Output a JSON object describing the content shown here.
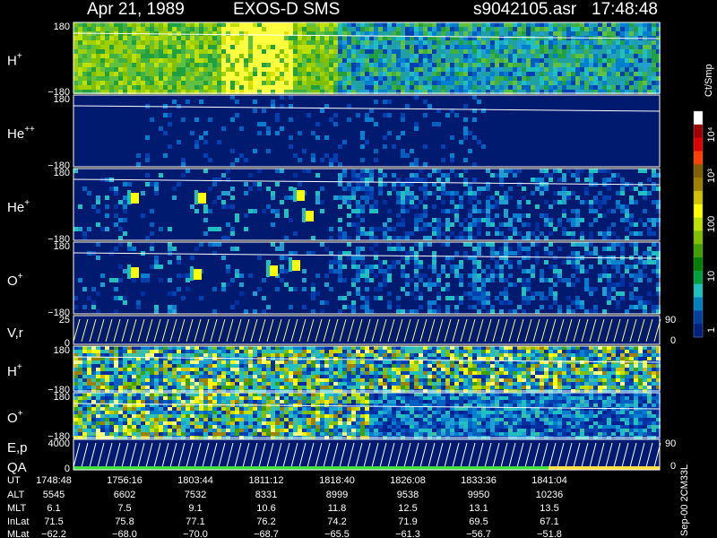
{
  "header": {
    "date": "Apr 21, 1989",
    "instrument": "EXOS-D SMS",
    "file": "s9042105.asr",
    "time": "17:48:48"
  },
  "panels": [
    {
      "label": "H",
      "sup": "+",
      "top_tick": "180",
      "bottom_tick": "−180"
    },
    {
      "label": "He",
      "sup": "++",
      "top_tick": "180",
      "bottom_tick": "−180"
    },
    {
      "label": "He",
      "sup": "+",
      "top_tick": "180",
      "bottom_tick": "−180"
    },
    {
      "label": "O",
      "sup": "+",
      "top_tick": "180",
      "bottom_tick": "−180"
    },
    {
      "label": "V,r",
      "sup": "",
      "top_tick": "25",
      "bottom_tick": "0",
      "right_top": "90",
      "right_bottom": "0"
    },
    {
      "label": "H",
      "sup": "+",
      "top_tick": "180",
      "bottom_tick": "−180"
    },
    {
      "label": "O",
      "sup": "+",
      "top_tick": "180",
      "bottom_tick": "−180"
    },
    {
      "label": "E,p",
      "label2": "QA",
      "sup": "",
      "top_tick": "4000",
      "bottom_tick": "0",
      "right_top": "90",
      "right_bottom": "0"
    }
  ],
  "colorbar": {
    "unit": "Ct/Smp",
    "labels": [
      "10⁴",
      "10³",
      "100",
      "10",
      "1"
    ],
    "colors": [
      "#ffffff",
      "#a00000",
      "#e00000",
      "#ff4000",
      "#806000",
      "#a08000",
      "#d0c000",
      "#ffff00",
      "#c0e000",
      "#80c000",
      "#40a000",
      "#008000",
      "#00a040",
      "#20c0c0",
      "#0080c0",
      "#0040a0",
      "#002080"
    ]
  },
  "footer_code": "Sep-00 2CM33L",
  "time_table": {
    "row_labels": [
      "UT",
      "ALT",
      "MLT",
      "InLat",
      "MLat"
    ],
    "columns": [
      [
        "1748:48",
        "5545",
        "6.1",
        "71.5",
        "−62.2"
      ],
      [
        "1756:16",
        "6602",
        "7.5",
        "75.8",
        "−68.0"
      ],
      [
        "1803:44",
        "7532",
        "9.1",
        "77.1",
        "−70.0"
      ],
      [
        "1811:12",
        "8331",
        "10.6",
        "76.2",
        "−68.7"
      ],
      [
        "1818:40",
        "8999",
        "11.8",
        "74.2",
        "−65.5"
      ],
      [
        "1826:08",
        "9538",
        "12.5",
        "71.9",
        "−61.3"
      ],
      [
        "1833:36",
        "9950",
        "13.1",
        "69.5",
        "−56.7"
      ],
      [
        "1841:04",
        "10236",
        "13.5",
        "67.1",
        "−51.8"
      ]
    ]
  },
  "chart_data": {
    "type": "heatmap",
    "title": "Apr 21, 1989  EXOS-D SMS",
    "xlabel": "UT",
    "x_ticks": [
      "1748:48",
      "1756:16",
      "1803:44",
      "1811:12",
      "1818:40",
      "1826:08",
      "1833:36",
      "1841:04"
    ],
    "series": [
      {
        "name": "H+",
        "ylim": [
          -180,
          180
        ]
      },
      {
        "name": "He++",
        "ylim": [
          -180,
          180
        ]
      },
      {
        "name": "He+",
        "ylim": [
          -180,
          180
        ]
      },
      {
        "name": "O+",
        "ylim": [
          -180,
          180
        ]
      },
      {
        "name": "V,r",
        "ylim": [
          0,
          25
        ]
      },
      {
        "name": "H+",
        "ylim": [
          -180,
          180
        ]
      },
      {
        "name": "O+",
        "ylim": [
          -180,
          180
        ]
      },
      {
        "name": "E,p",
        "ylim": [
          0,
          4000
        ]
      }
    ],
    "color_scale": "log",
    "color_range": [
      1,
      10000
    ]
  }
}
